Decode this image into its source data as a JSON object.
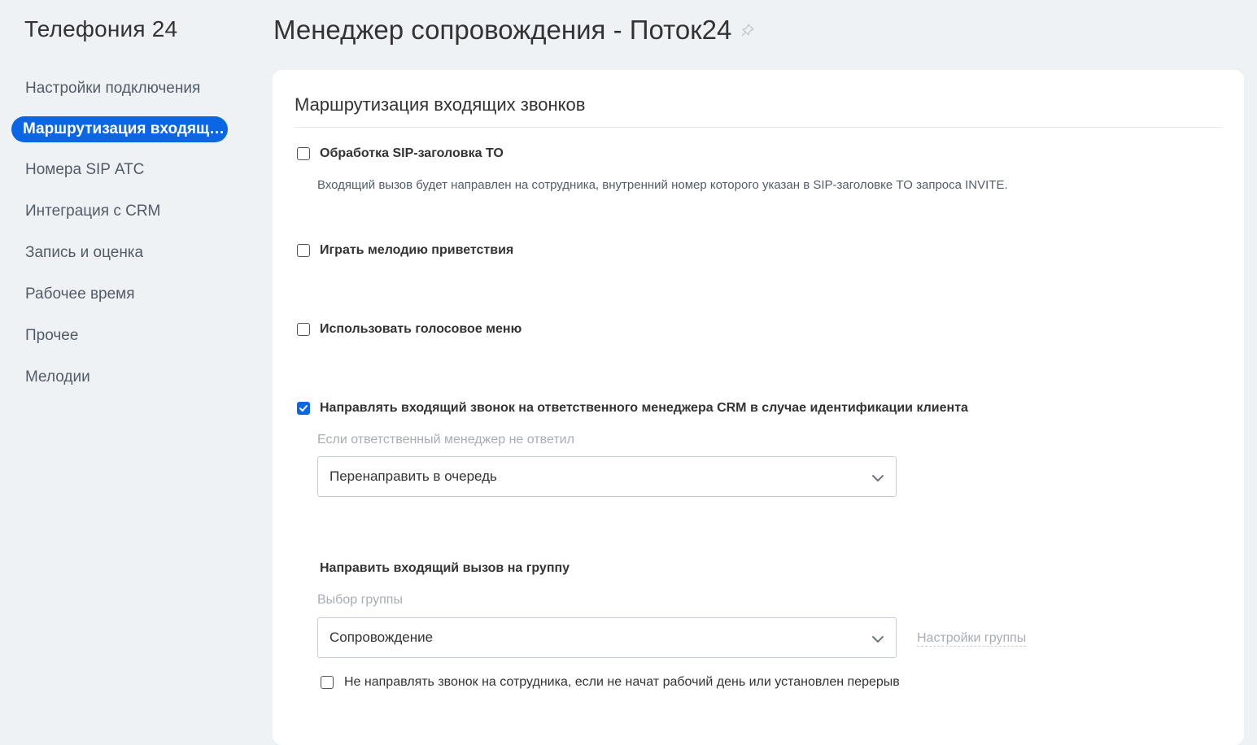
{
  "app": {
    "title": "Телефония 24"
  },
  "header": {
    "title": "Менеджер сопровождения - Поток24"
  },
  "sidebar": {
    "items": [
      {
        "label": "Настройки подключения"
      },
      {
        "label": "Маршрутизация входящих звонков"
      },
      {
        "label": "Номера SIP АТС"
      },
      {
        "label": "Интеграция с CRM"
      },
      {
        "label": "Запись и оценка"
      },
      {
        "label": "Рабочее время"
      },
      {
        "label": "Прочее"
      },
      {
        "label": "Мелодии"
      }
    ],
    "active_index": 1
  },
  "main": {
    "section_title": "Маршрутизация входящих звонков",
    "options": {
      "sip_to": {
        "label": "Обработка SIP-заголовка TO",
        "checked": false,
        "description": "Входящий вызов будет направлен на сотрудника, внутренний номер которого указан в SIP-заголовке TO запроса INVITE."
      },
      "greeting": {
        "label": "Играть мелодию приветствия",
        "checked": false
      },
      "ivr": {
        "label": "Использовать голосовое меню",
        "checked": false
      },
      "crm_manager": {
        "label": "Направлять входящий звонок на ответственного менеджера CRM в случае идентификации клиента",
        "checked": true,
        "hint": "Если ответственный менеджер не ответил",
        "select_value": "Перенаправить в очередь"
      }
    },
    "group": {
      "heading": "Направить входящий вызов на группу",
      "hint": "Выбор группы",
      "select_value": "Сопровождение",
      "settings_link": "Настройки группы",
      "no_break_option": {
        "label": "Не направлять звонок на сотрудника, если не начат рабочий день или установлен перерыв",
        "checked": false
      }
    }
  },
  "colors": {
    "accent": "#0b66e4",
    "background": "#eef2f4",
    "muted": "#a8adb4"
  },
  "icons": {
    "pin": "pin-icon",
    "chevron": "chevron-down-icon",
    "check": "check-icon"
  }
}
